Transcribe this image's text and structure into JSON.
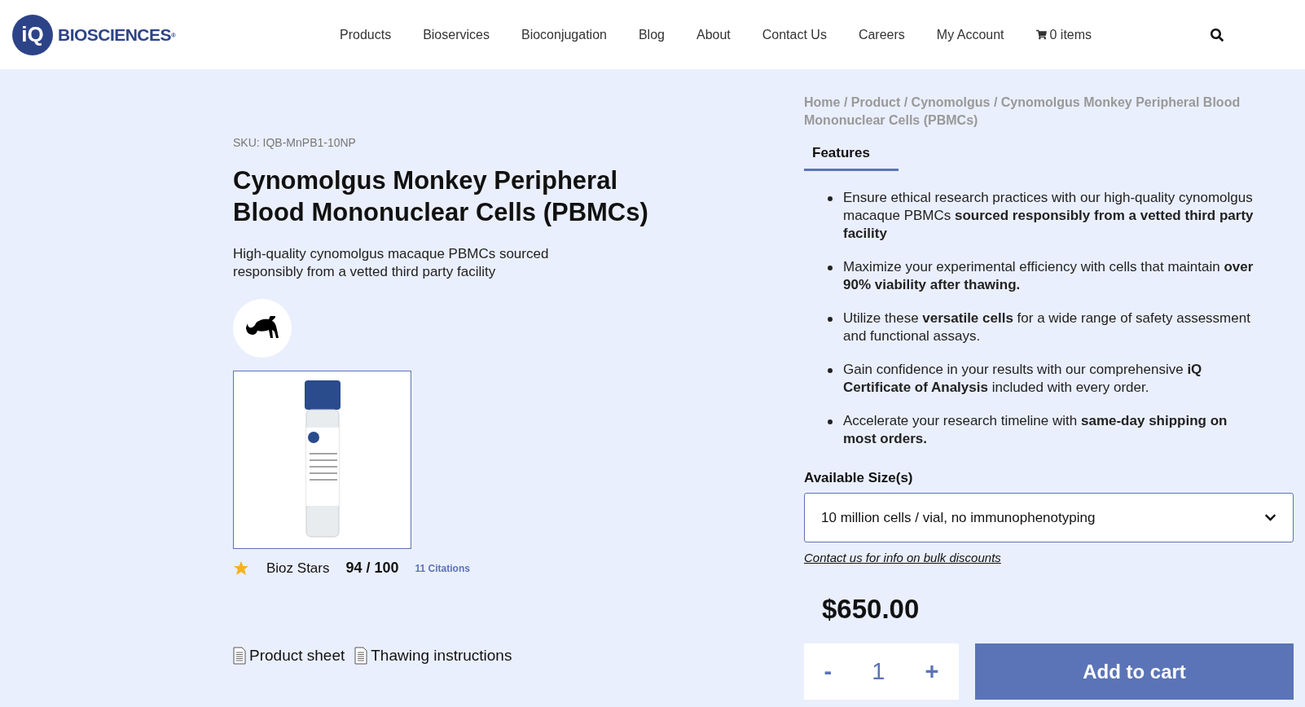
{
  "header": {
    "logo": {
      "mark": "iQ",
      "name": "BIOSCIENCES",
      "registered": "®"
    },
    "nav": [
      "Products",
      "Bioservices",
      "Bioconjugation",
      "Blog",
      "About",
      "Contact Us",
      "Careers",
      "My Account"
    ],
    "cart": {
      "label": "0 items"
    }
  },
  "breadcrumb": "Home / Product / Cynomolgus / Cynomolgus Monkey Peripheral Blood Mononuclear Cells (PBMCs)",
  "product": {
    "sku": "SKU: IQB-MnPB1-10NP",
    "title": "Cynomolgus Monkey Peripheral Blood Mononuclear Cells (PBMCs)",
    "subtitle": "High-quality cynomolgus macaque PBMCs sourced responsibly from a vetted third party facility",
    "bioz": {
      "label": "Bioz Stars",
      "score": "94 / 100",
      "citations": "11 Citations"
    },
    "documents": [
      "Product sheet",
      "Thawing instructions"
    ]
  },
  "tabs": [
    {
      "label": "Features",
      "selected": true
    }
  ],
  "features": [
    "Ensure ethical research practices with our high-quality cynomolgus macaque PBMCs **sourced responsibly from a vetted third party facility**",
    "Maximize your experimental efficiency with cells that maintain **over 90% viability after thawing.**",
    "Utilize these **versatile cells** for a wide range of safety assessment and functional assays.",
    "Gain confidence in your results with our comprehensive **iQ Certificate of Analysis** included with every order.",
    "Accelerate your research timeline with **same-day shipping on most orders.**"
  ],
  "sizes": {
    "label": "Available Size(s)",
    "value": "10 million cells / vial, no immunophenotyping",
    "bulk_link": "Contact us for info on bulk discounts"
  },
  "price": "$650.00",
  "quantity": {
    "minus": "-",
    "value": "1",
    "plus": "+"
  },
  "add_to_cart": "Add to cart"
}
